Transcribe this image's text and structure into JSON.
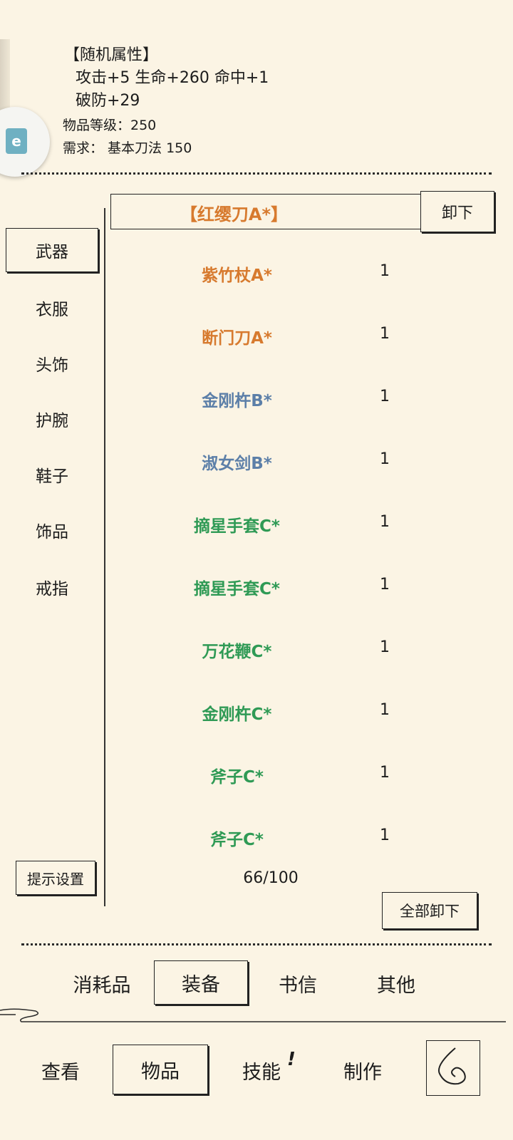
{
  "item_detail": {
    "random_attr_header": "【随机属性】",
    "attr_line1": "攻击+5 生命+260 命中+1",
    "attr_line2": "破防+29",
    "item_level": "物品等级：250",
    "requirement": "需求： 基本刀法 150",
    "overlay_badge_text": "e"
  },
  "equipped": {
    "name": "【红缨刀A*】",
    "unequip_label": "卸下"
  },
  "categories": [
    {
      "label": "武器",
      "selected": true
    },
    {
      "label": "衣服",
      "selected": false
    },
    {
      "label": "头饰",
      "selected": false
    },
    {
      "label": "护腕",
      "selected": false
    },
    {
      "label": "鞋子",
      "selected": false
    },
    {
      "label": "饰品",
      "selected": false
    },
    {
      "label": "戒指",
      "selected": false
    }
  ],
  "items": [
    {
      "name": "紫竹杖A*",
      "count": "1",
      "tier": "orange"
    },
    {
      "name": "断门刀A*",
      "count": "1",
      "tier": "orange"
    },
    {
      "name": "金刚杵B*",
      "count": "1",
      "tier": "blue"
    },
    {
      "name": "淑女剑B*",
      "count": "1",
      "tier": "blue"
    },
    {
      "name": "摘星手套C*",
      "count": "1",
      "tier": "green"
    },
    {
      "name": "摘星手套C*",
      "count": "1",
      "tier": "green"
    },
    {
      "name": "万花鞭C*",
      "count": "1",
      "tier": "green"
    },
    {
      "name": "金刚杵C*",
      "count": "1",
      "tier": "green"
    },
    {
      "name": "斧子C*",
      "count": "1",
      "tier": "green"
    },
    {
      "name": "斧子C*",
      "count": "1",
      "tier": "green"
    }
  ],
  "capacity": "66/100",
  "hint_settings_label": "提示设置",
  "unequip_all_label": "全部卸下",
  "sub_tabs": [
    {
      "label": "消耗品",
      "selected": false
    },
    {
      "label": "装备",
      "selected": true
    },
    {
      "label": "书信",
      "selected": false
    },
    {
      "label": "其他",
      "selected": false
    }
  ],
  "bottom_nav": [
    {
      "label": "查看",
      "selected": false
    },
    {
      "label": "物品",
      "selected": true
    },
    {
      "label": "技能",
      "selected": false,
      "badge": "!"
    },
    {
      "label": "制作",
      "selected": false
    }
  ],
  "colors": {
    "background": "#fbf4e4",
    "orange_tier": "#d77a2e",
    "blue_tier": "#5c7fa8",
    "green_tier": "#2f9a55"
  },
  "icons": {
    "back": "back-icon",
    "overlay": "floating-overlay-icon"
  }
}
